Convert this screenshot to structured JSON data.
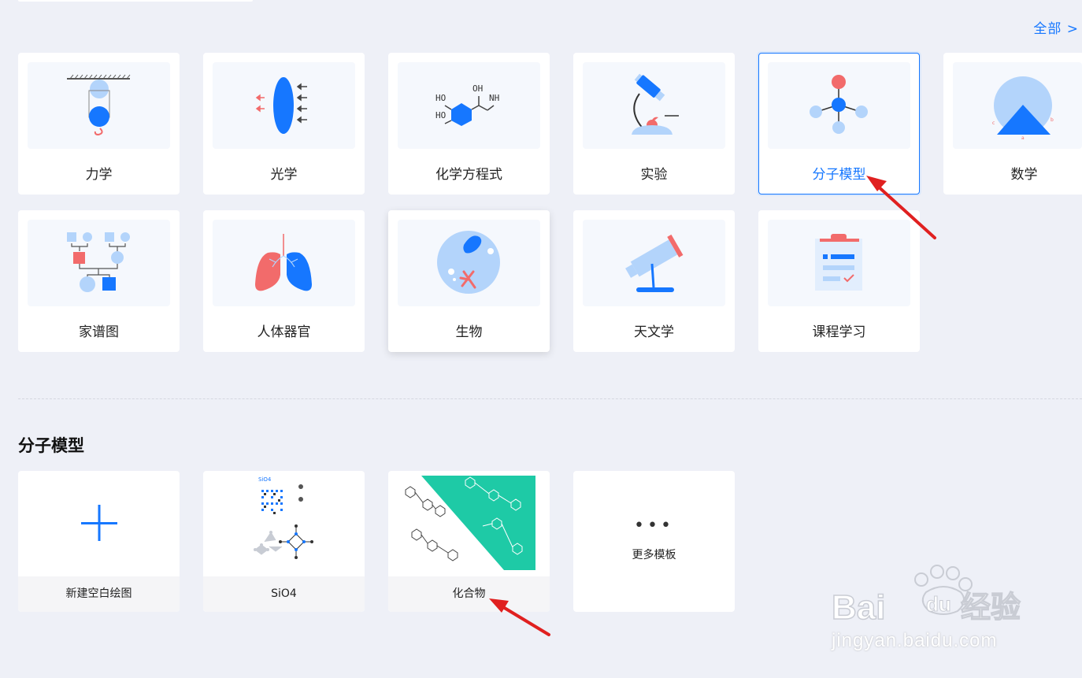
{
  "header": {
    "all_link": "全部 >"
  },
  "categories": [
    {
      "label": "力学",
      "icon": "pendulum-icon"
    },
    {
      "label": "光学",
      "icon": "lens-icon"
    },
    {
      "label": "化学方程式",
      "icon": "benzene-icon"
    },
    {
      "label": "实验",
      "icon": "microscope-icon"
    },
    {
      "label": "分子模型",
      "icon": "molecule-icon",
      "selected": true
    },
    {
      "label": "数学",
      "icon": "geometry-icon"
    },
    {
      "label": "家谱图",
      "icon": "family-tree-icon"
    },
    {
      "label": "人体器官",
      "icon": "lungs-icon"
    },
    {
      "label": "生物",
      "icon": "cell-icon"
    },
    {
      "label": "天文学",
      "icon": "telescope-icon"
    },
    {
      "label": "课程学习",
      "icon": "clipboard-icon"
    }
  ],
  "section": {
    "title": "分子模型"
  },
  "templates": [
    {
      "label": "新建空白绘图",
      "icon": "plus-icon"
    },
    {
      "label": "SiO4",
      "thumb_text": "SiO4"
    },
    {
      "label": "化合物"
    },
    {
      "label": "更多模板",
      "icon": "more-dots-icon",
      "dots": "•••"
    }
  ],
  "watermark": {
    "brand": "Bai du 经验",
    "url": "jingyan.baidu.com"
  },
  "colors": {
    "accent": "#1677ff",
    "light_blue": "#b3d4fb",
    "red": "#f26b6b",
    "teal": "#1ecaa6"
  }
}
